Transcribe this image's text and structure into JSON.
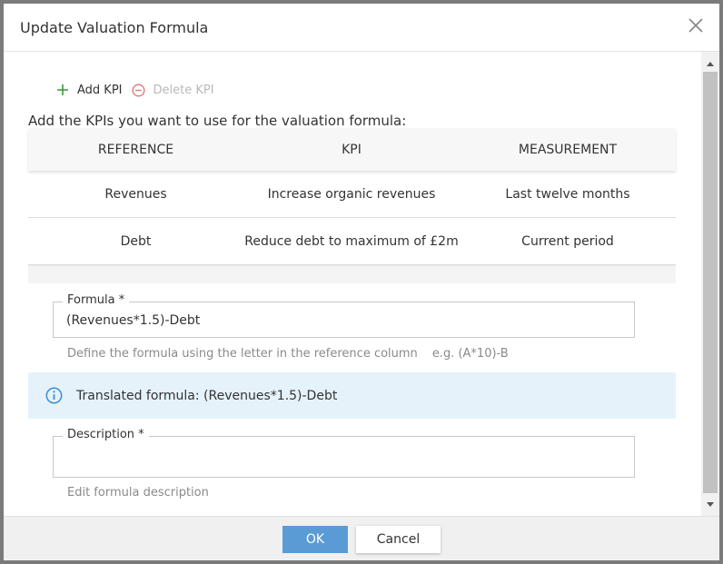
{
  "dialog": {
    "title": "Update Valuation Formula",
    "close_icon": "close-icon"
  },
  "toolbar": {
    "add_label": "Add KPI",
    "add_icon": "plus-icon",
    "delete_label": "Delete KPI",
    "delete_icon": "minus-circle-icon"
  },
  "intro": "Add the KPIs you want to use for the valuation formula:",
  "table": {
    "headers": [
      "REFERENCE",
      "KPI",
      "MEASUREMENT"
    ],
    "rows": [
      [
        "Revenues",
        "Increase organic revenues",
        "Last twelve months"
      ],
      [
        "Debt",
        "Reduce debt to maximum of £2m",
        "Current period"
      ]
    ]
  },
  "formula": {
    "label": "Formula *",
    "value": "(Revenues*1.5)-Debt",
    "hint": "Define the formula using the letter in the reference column",
    "example": "e.g. (A*10)-B"
  },
  "translated": {
    "text": "Translated formula: (Revenues*1.5)-Debt",
    "icon": "info-icon"
  },
  "description": {
    "label": "Description *",
    "value": "",
    "hint": "Edit formula description"
  },
  "footer": {
    "ok_label": "OK",
    "cancel_label": "Cancel"
  },
  "colors": {
    "accent": "#5b9bd5",
    "add_icon": "#3a9a3a",
    "delete_icon": "#e07070",
    "info_bg": "#e5f2fa",
    "info_icon": "#3a8fd0"
  }
}
